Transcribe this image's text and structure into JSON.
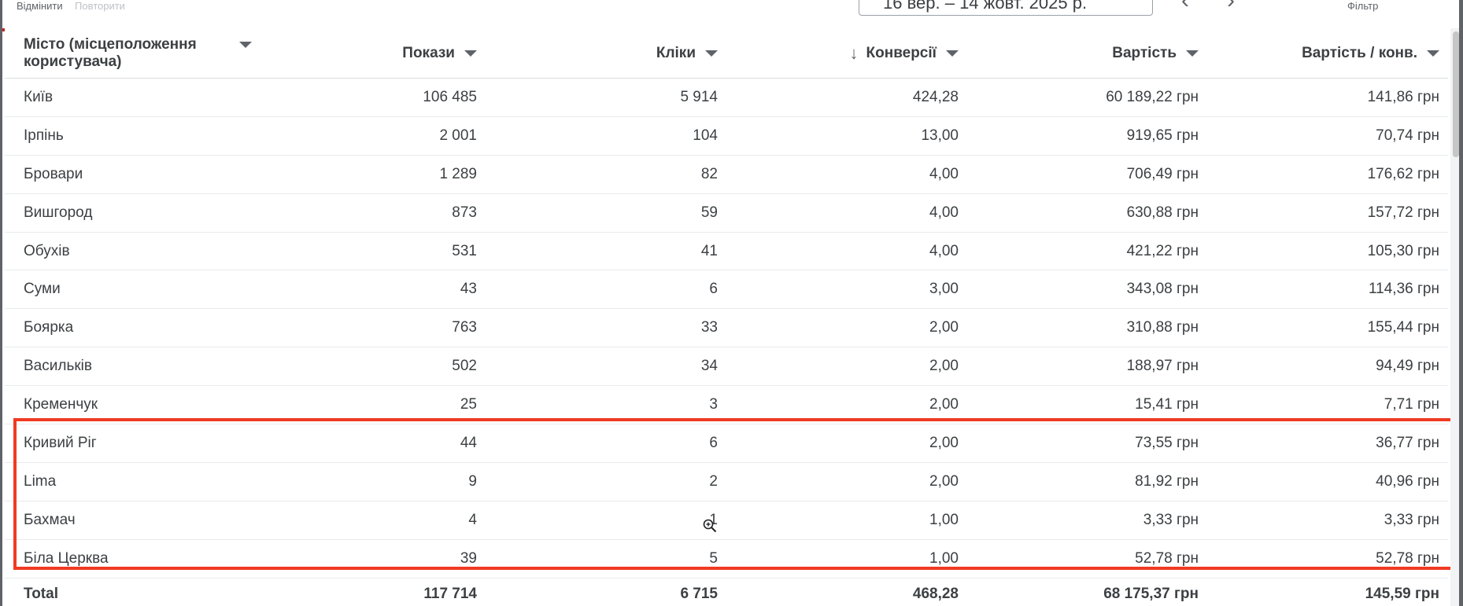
{
  "toolbar": {
    "undo_label": "Відмінити",
    "redo_label": "Повторити",
    "date_range": "16 вер. – 14 жовт. 2025 р.",
    "prev_icon": "chevron-left-icon",
    "next_icon": "chevron-right-icon",
    "filter_label": "Фільтр"
  },
  "table": {
    "headers": {
      "city": "Місто (місцеположення користувача)",
      "impressions": "Покази",
      "clicks": "Кліки",
      "conversions": "Конверсії",
      "cost": "Вартість",
      "cost_per_conv": "Вартість / конв."
    },
    "sort_column": "conversions",
    "rows": [
      {
        "city": "Київ",
        "impressions": "106 485",
        "clicks": "5 914",
        "conversions": "424,28",
        "cost": "60 189,22 грн",
        "cpc": "141,86 грн"
      },
      {
        "city": "Ірпінь",
        "impressions": "2 001",
        "clicks": "104",
        "conversions": "13,00",
        "cost": "919,65 грн",
        "cpc": "70,74 грн"
      },
      {
        "city": "Бровари",
        "impressions": "1 289",
        "clicks": "82",
        "conversions": "4,00",
        "cost": "706,49 грн",
        "cpc": "176,62 грн"
      },
      {
        "city": "Вишгород",
        "impressions": "873",
        "clicks": "59",
        "conversions": "4,00",
        "cost": "630,88 грн",
        "cpc": "157,72 грн"
      },
      {
        "city": "Обухів",
        "impressions": "531",
        "clicks": "41",
        "conversions": "4,00",
        "cost": "421,22 грн",
        "cpc": "105,30 грн"
      },
      {
        "city": "Суми",
        "impressions": "43",
        "clicks": "6",
        "conversions": "3,00",
        "cost": "343,08 грн",
        "cpc": "114,36 грн"
      },
      {
        "city": "Боярка",
        "impressions": "763",
        "clicks": "33",
        "conversions": "2,00",
        "cost": "310,88 грн",
        "cpc": "155,44 грн"
      },
      {
        "city": "Васильків",
        "impressions": "502",
        "clicks": "34",
        "conversions": "2,00",
        "cost": "188,97 грн",
        "cpc": "94,49 грн"
      },
      {
        "city": "Кременчук",
        "impressions": "25",
        "clicks": "3",
        "conversions": "2,00",
        "cost": "15,41 грн",
        "cpc": "7,71 грн"
      },
      {
        "city": "Кривий Ріг",
        "impressions": "44",
        "clicks": "6",
        "conversions": "2,00",
        "cost": "73,55 грн",
        "cpc": "36,77 грн"
      },
      {
        "city": "Lima",
        "impressions": "9",
        "clicks": "2",
        "conversions": "2,00",
        "cost": "81,92 грн",
        "cpc": "40,96 грн"
      },
      {
        "city": "Бахмач",
        "impressions": "4",
        "clicks": "1",
        "conversions": "1,00",
        "cost": "3,33 грн",
        "cpc": "3,33 грн"
      },
      {
        "city": "Біла Церква",
        "impressions": "39",
        "clicks": "5",
        "conversions": "1,00",
        "cost": "52,78 грн",
        "cpc": "52,78 грн"
      }
    ],
    "total": {
      "label": "Total",
      "impressions": "117 714",
      "clicks": "6 715",
      "conversions": "468,28",
      "cost": "68 175,37 грн",
      "cpc": "145,59 грн"
    }
  },
  "colors": {
    "highlight_border": "#f03a22",
    "text": "#3c4043",
    "divider": "#e8eaed"
  }
}
